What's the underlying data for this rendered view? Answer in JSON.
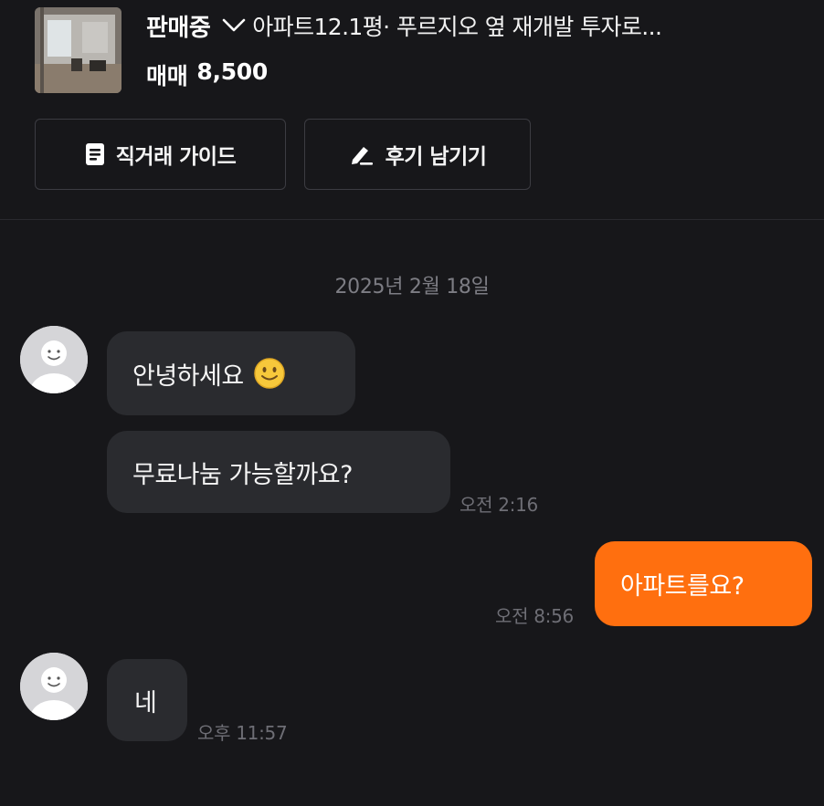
{
  "listing": {
    "status": "판매중",
    "title": "아파트12.1평· 푸르지오 옆 재개발 투자로...",
    "price_type": "매매",
    "price": "8,500",
    "thumbnail_icon": "apartment-room-photo"
  },
  "actions": {
    "guide_label": "직거래 가이드",
    "guide_icon": "document-icon",
    "review_label": "후기 남기기",
    "review_icon": "pencil-icon"
  },
  "chat": {
    "date": "2025년 2월 18일",
    "messages": [
      {
        "sender": "other",
        "text": "안녕하세요",
        "emoji": "slightly-smiling-face"
      },
      {
        "sender": "other",
        "text": "무료나눔 가능할까요?",
        "time": "오전 2:16"
      },
      {
        "sender": "me",
        "text": "아파트를요?",
        "time": "오전 8:56"
      },
      {
        "sender": "other",
        "text": "네",
        "time": "오후 11:57"
      }
    ]
  },
  "colors": {
    "background": "#17171a",
    "bubble_other": "#2a2b2f",
    "bubble_mine": "#ff6f0f",
    "muted_text": "#7d7d84"
  }
}
